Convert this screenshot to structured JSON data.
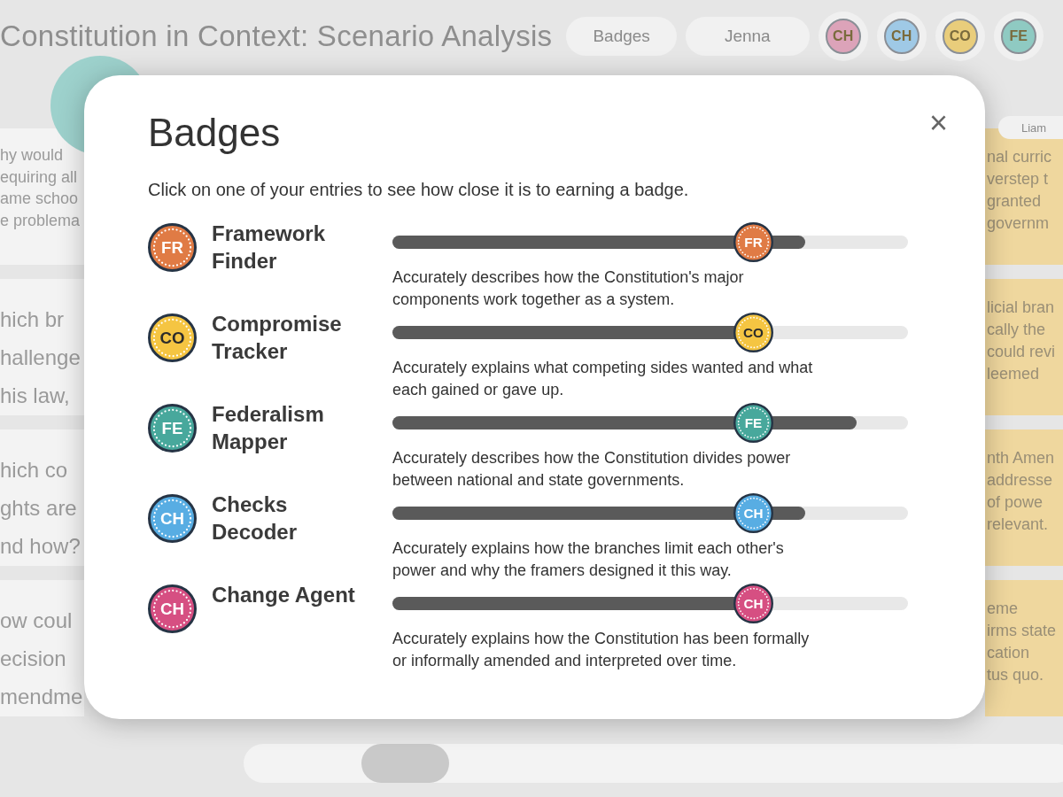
{
  "header": {
    "title": "Constitution in Context: Scenario Analysis",
    "buttons": [
      "Badges",
      "Jenna"
    ],
    "badges": [
      {
        "code": "CH",
        "color": "#dca3b9"
      },
      {
        "code": "CH",
        "color": "#9fc9e6"
      },
      {
        "code": "CO",
        "color": "#e9cd7b"
      },
      {
        "code": "FE",
        "color": "#8fcac2"
      }
    ]
  },
  "left_cards": [
    {
      "kind": "small",
      "lines": [
        "hy would",
        "equiring all",
        "ame schoo",
        "e problema"
      ]
    },
    {
      "kind": "large",
      "lines": [
        "hich br",
        "hallenge",
        "his law,"
      ]
    },
    {
      "kind": "large",
      "lines": [
        "hich co",
        "ghts are",
        "nd how?"
      ]
    },
    {
      "kind": "large",
      "lines": [
        "ow coul",
        "ecision",
        "mendme"
      ]
    }
  ],
  "right_column": {
    "name": "Liam",
    "cards": [
      [
        "nal curric",
        "verstep t",
        "granted",
        "governm"
      ],
      [
        "licial bran",
        "cally the",
        "could revi",
        "leemed"
      ],
      [
        "nth Amen",
        "addresse",
        "of powe",
        "relevant."
      ],
      [
        "eme",
        "irms state",
        "cation",
        "tus quo."
      ]
    ]
  },
  "modal": {
    "title": "Badges",
    "close": "×",
    "intro": "Click on one of your entries to see how close it is to earning a badge.",
    "badges": [
      {
        "code": "FR",
        "marker_code": "FR",
        "name": "Framework Finder",
        "color": "#e07b45",
        "level": 0.8,
        "description": "Accurately describes how the Constitution's major components work together as a system."
      },
      {
        "code": "CO",
        "marker_code": "CO",
        "name": "Compromise Tracker",
        "color": "#f5c542",
        "level": 0.72,
        "description": "Accurately explains what competing sides wanted and what each gained or gave up."
      },
      {
        "code": "FE",
        "marker_code": "FE",
        "name": "Federalism Mapper",
        "color": "#48a89c",
        "level": 0.9,
        "description": "Accurately describes how the Constitution divides power between national and state governments."
      },
      {
        "code": "CH",
        "marker_code": "CH",
        "name": "Checks Decoder",
        "color": "#58ade3",
        "level": 0.8,
        "description": "Accurately explains how the branches limit each other's power and why the framers designed it this way."
      },
      {
        "code": "CH",
        "marker_code": "CH",
        "name": "Change Agent",
        "color": "#d64f82",
        "level": 0.72,
        "description": "Accurately explains how the Constitution has been formally or informally amended and interpreted over time."
      }
    ]
  }
}
